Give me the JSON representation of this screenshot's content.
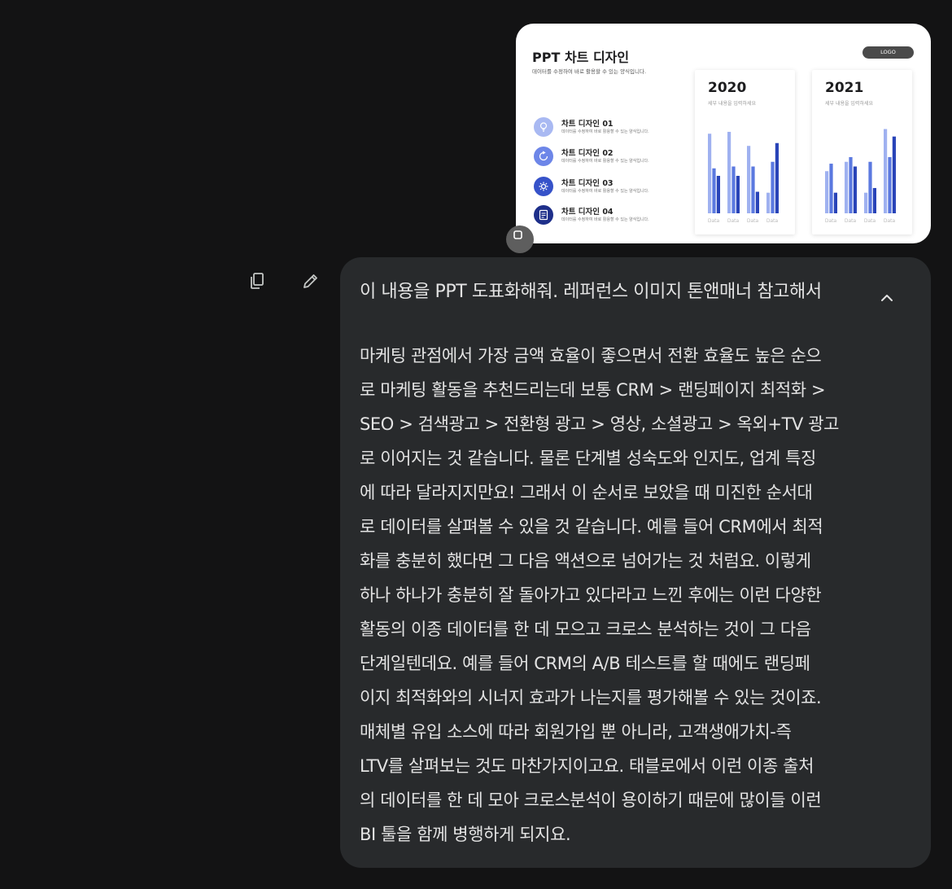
{
  "attachment": {
    "slide_title": "PPT 차트 디자인",
    "slide_subtitle": "데이터를 수정하여 바로 활용할 수 있는 양식입니다.",
    "logo_label": "LOGO",
    "list_items": [
      {
        "title": "차트 디자인 01",
        "desc": "데이터를 수정하여 바로 활용할 수 있는 양식입니다.",
        "color": "#a9b9f2",
        "icon": "bulb-icon"
      },
      {
        "title": "차트 디자인 02",
        "desc": "데이터를 수정하여 바로 활용할 수 있는 양식입니다.",
        "color": "#6d86e8",
        "icon": "refresh-icon"
      },
      {
        "title": "차트 디자인 03",
        "desc": "데이터를 수정하여 바로 활용할 수 있는 양식입니다.",
        "color": "#3652c9",
        "icon": "gear-icon"
      },
      {
        "title": "차트 디자인 04",
        "desc": "데이터를 수정하여 바로 활용할 수 있는 양식입니다.",
        "color": "#1e2f8a",
        "icon": "document-icon"
      }
    ],
    "panels": [
      {
        "year": "2020",
        "subtitle": "세부 내용을 입력하세요",
        "categories": [
          "Data",
          "Data",
          "Data",
          "Data"
        ],
        "series": [
          [
            85,
            87,
            72,
            22
          ],
          [
            48,
            50,
            50,
            55
          ],
          [
            40,
            40,
            23,
            75
          ]
        ]
      },
      {
        "year": "2021",
        "subtitle": "세부 내용을 입력하세요",
        "categories": [
          "Data",
          "Data",
          "Data",
          "Data"
        ],
        "series": [
          [
            45,
            55,
            22,
            90
          ],
          [
            53,
            60,
            55,
            60
          ],
          [
            22,
            50,
            27,
            82
          ]
        ]
      }
    ],
    "series_colors": [
      "#9fb1f0",
      "#5b79e0",
      "#2944b8"
    ]
  },
  "actions": {
    "copy_icon": "copy-icon",
    "edit_icon": "pencil-icon"
  },
  "message": {
    "prompt": "이 내용을 PPT 도표화해줘. 레퍼런스 이미지 톤앤매너 참고해서",
    "body_lines": [
      "마케팅 관점에서 가장 금액 효율이 좋으면서 전환 효율도 높은 순으",
      "로 마케팅 활동을 추천드리는데 보통 CRM > 랜딩페이지 최적화 >",
      "SEO > 검색광고 > 전환형 광고 > 영상, 소셜광고 > 옥외+TV 광고",
      "로 이어지는 것 같습니다. 물론 단계별 성숙도와 인지도, 업계 특징",
      "에 따라 달라지지만요! 그래서 이 순서로 보았을 때 미진한 순서대",
      "로 데이터를 살펴볼 수 있을 것 같습니다. 예를 들어 CRM에서 최적",
      "화를 충분히 했다면 그 다음 액션으로 넘어가는 것 처럼요. 이렇게",
      "하나 하나가 충분히 잘 돌아가고 있다라고 느낀 후에는 이런 다양한",
      "활동의 이종 데이터를 한 데 모으고 크로스 분석하는 것이 그 다음",
      "단계일텐데요. 예를 들어 CRM의 A/B 테스트를 할 때에도 랜딩페",
      "이지 최적화와의 시너지 효과가 나는지를 평가해볼 수 있는 것이죠.",
      "매체별 유입 소스에 따라 회원가입 뿐 아니라, 고객생애가치-즉",
      "LTV를 살펴보는 것도 마찬가지이고요. 태블로에서 이런 이종 출처",
      "의 데이터를 한 데 모아 크로스분석이 용이하기 때문에 많이들 이런",
      "BI 툴을 함께 병행하게 되지요."
    ]
  }
}
